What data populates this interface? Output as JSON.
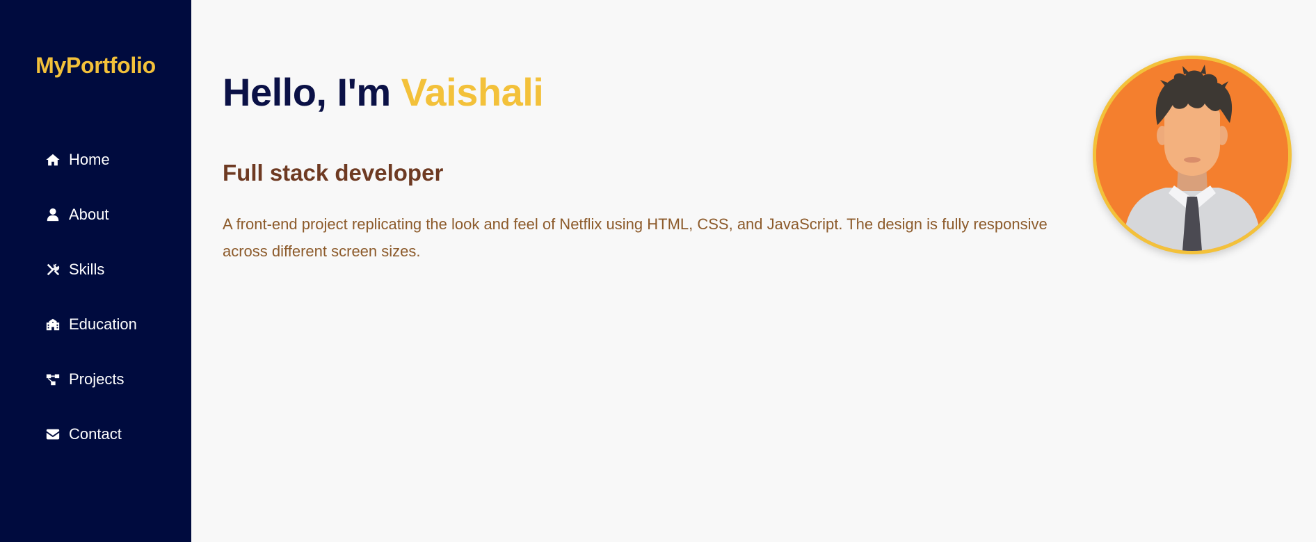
{
  "sidebar": {
    "logo": "MyPortfolio",
    "items": [
      {
        "label": "Home",
        "icon": "home-icon"
      },
      {
        "label": "About",
        "icon": "user-icon"
      },
      {
        "label": "Skills",
        "icon": "tools-icon"
      },
      {
        "label": "Education",
        "icon": "school-icon"
      },
      {
        "label": "Projects",
        "icon": "project-diagram-icon"
      },
      {
        "label": "Contact",
        "icon": "envelope-icon"
      }
    ]
  },
  "hero": {
    "greeting": "Hello, I'm ",
    "name": "Vaishali",
    "role": "Full stack developer",
    "description": "A front-end project replicating the look and feel of Netflix using HTML, CSS, and JavaScript. The design is fully responsive across different screen sizes.",
    "avatar_icon": "profile-avatar"
  },
  "colors": {
    "sidebar_bg": "#000b3e",
    "accent": "#f3c13a",
    "heading": "#0b1146",
    "role": "#6e3a22",
    "description": "#8c5a2a",
    "avatar_bg": "#f47f2e"
  }
}
